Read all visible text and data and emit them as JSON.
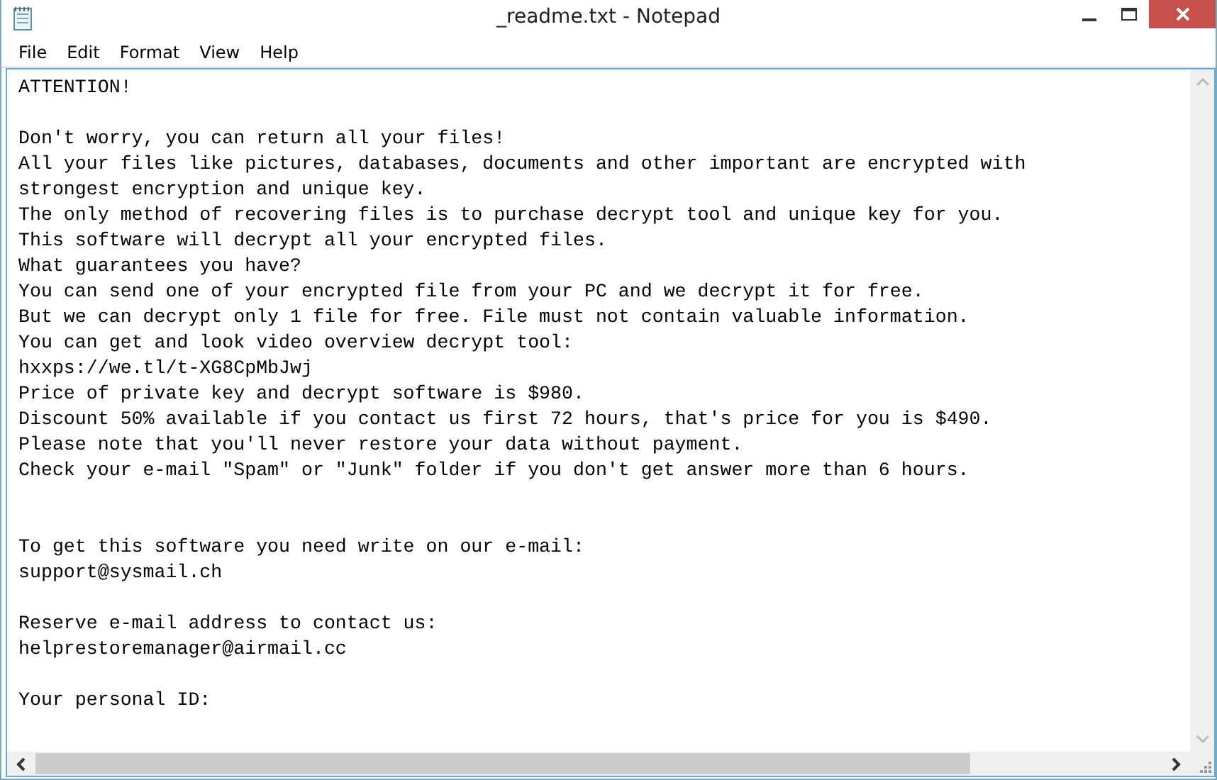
{
  "window": {
    "title": "_readme.txt - Notepad"
  },
  "menu": [
    "File",
    "Edit",
    "Format",
    "View",
    "Help"
  ],
  "document": {
    "lines": [
      {
        "kind": "text",
        "text": "ATTENTION!"
      },
      {
        "kind": "blank"
      },
      {
        "kind": "text",
        "text": "Don't worry, you can return all your files!"
      },
      {
        "kind": "text",
        "text": "All your files like pictures, databases, documents and other important are encrypted with"
      },
      {
        "kind": "text",
        "text": "strongest encryption and unique key."
      },
      {
        "kind": "text",
        "text": "The only method of recovering files is to purchase decrypt tool and unique key for you."
      },
      {
        "kind": "text",
        "text": "This software will decrypt all your encrypted files."
      },
      {
        "kind": "text",
        "text": "What guarantees you have?"
      },
      {
        "kind": "text",
        "text": "You can send one of your encrypted file from your PC and we decrypt it for free."
      },
      {
        "kind": "text",
        "text": "But we can decrypt only 1 file for free. File must not contain valuable information."
      },
      {
        "kind": "text",
        "text": "You can get and look video overview decrypt tool:"
      },
      {
        "kind": "text",
        "text": "hxxps://we.tl/t-XG8CpMbJwj"
      },
      {
        "kind": "text",
        "text": "Price of private key and decrypt software is $980."
      },
      {
        "kind": "text",
        "text": "Discount 50% available if you contact us first 72 hours, that's price for you is $490."
      },
      {
        "kind": "text",
        "text": "Please note that you'll never restore your data without payment."
      },
      {
        "kind": "text",
        "text": "Check your e-mail \"Spam\" or \"Junk\" folder if you don't get answer more than 6 hours."
      },
      {
        "kind": "blank"
      },
      {
        "kind": "blank"
      },
      {
        "kind": "text",
        "text": "To get this software you need write on our e-mail:"
      },
      {
        "kind": "text",
        "text": "support@sysmail.ch"
      },
      {
        "kind": "blank"
      },
      {
        "kind": "text",
        "text": "Reserve e-mail address to contact us:"
      },
      {
        "kind": "text",
        "text": "helprestoremanager@airmail.cc"
      },
      {
        "kind": "blank"
      },
      {
        "kind": "text",
        "text": "Your personal ID:"
      }
    ]
  }
}
